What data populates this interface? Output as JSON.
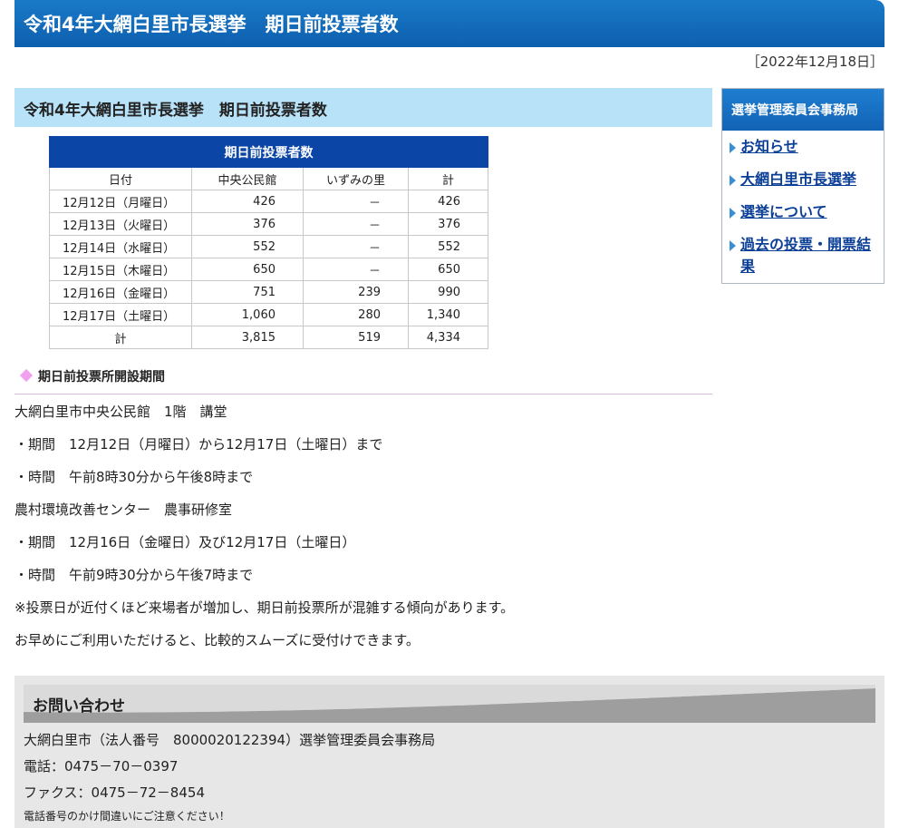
{
  "header": {
    "title": "令和4年大網白里市長選挙　期日前投票者数"
  },
  "update_date": "［2022年12月18日］",
  "main": {
    "heading": "令和4年大網白里市長選挙　期日前投票者数",
    "table": {
      "caption": "期日前投票者数",
      "columns": [
        "日付",
        "中央公民館",
        "いずみの里",
        "計"
      ],
      "rows": [
        [
          "12月12日（月曜日）",
          "426",
          "－",
          "426"
        ],
        [
          "12月13日（火曜日）",
          "376",
          "－",
          "376"
        ],
        [
          "12月14日（水曜日）",
          "552",
          "－",
          "552"
        ],
        [
          "12月15日（木曜日）",
          "650",
          "－",
          "650"
        ],
        [
          "12月16日（金曜日）",
          "751",
          "239",
          "990"
        ],
        [
          "12月17日（土曜日）",
          "1,060",
          "280",
          "1,340"
        ],
        [
          "計",
          "3,815",
          "519",
          "4,334"
        ]
      ]
    },
    "section_title": "期日前投票所開設期間",
    "paragraphs": [
      "大網白里市中央公民館　1階　講堂",
      "・期間　12月12日（月曜日）から12月17日（土曜日）まで",
      "・時間　午前8時30分から午後8時まで",
      "農村環境改善センター　農事研修室",
      "・期間　12月16日（金曜日）及び12月17日（土曜日）",
      "・時間　午前9時30分から午後7時まで",
      "※投票日が近付くほど来場者が増加し、期日前投票所が混雑する傾向があります。",
      "お早めにご利用いただけると、比較的スムーズに受付けできます。"
    ]
  },
  "sidebar": {
    "title": "選挙管理委員会事務局",
    "links": [
      {
        "label": "お知らせ"
      },
      {
        "label": "大網白里市長選挙"
      },
      {
        "label": "選挙について"
      },
      {
        "label": "過去の投票・開票結果"
      }
    ]
  },
  "contact": {
    "title": "お問い合わせ",
    "org": "大網白里市（法人番号　8000020122394）選挙管理委員会事務局",
    "phone": "電話：0475－70－0397",
    "fax": "ファクス：0475－72－8454",
    "note": "電話番号のかけ間違いにご注意ください！"
  }
}
